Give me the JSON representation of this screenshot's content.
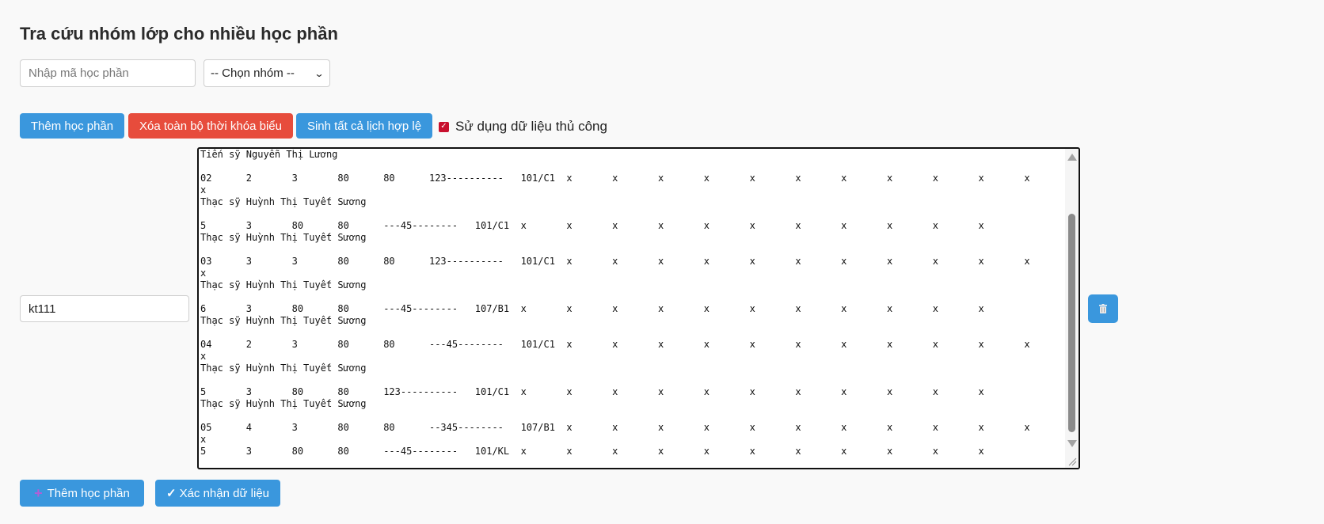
{
  "page": {
    "title": "Tra cứu nhóm lớp cho nhiều học phần"
  },
  "search": {
    "placeholder": "Nhập mã học phần",
    "group_select": "-- Chọn nhóm --"
  },
  "toolbar": {
    "add_course": "Thêm học phần",
    "clear_all": "Xóa toàn bộ thời khóa biểu",
    "generate_all": "Sinh tất cả lịch hợp lệ",
    "manual_data_label": "Sử dụng dữ liệu thủ công",
    "manual_data_checked": true
  },
  "course_row": {
    "code": "kt111",
    "data": "Tiến sỹ Nguyễn Thị Lương\n\n02      2       3       80      80      123----------   101/C1  x       x       x       x       x       x       x       x       x       x       x\nx\nThạc sỹ Huỳnh Thị Tuyết Sương\n\n5       3       80      80      ---45--------   101/C1  x       x       x       x       x       x       x       x       x       x       x\nThạc sỹ Huỳnh Thị Tuyết Sương\n\n03      3       3       80      80      123----------   101/C1  x       x       x       x       x       x       x       x       x       x       x\nx\nThạc sỹ Huỳnh Thị Tuyết Sương\n\n6       3       80      80      ---45--------   107/B1  x       x       x       x       x       x       x       x       x       x       x\nThạc sỹ Huỳnh Thị Tuyết Sương\n\n04      2       3       80      80      ---45--------   101/C1  x       x       x       x       x       x       x       x       x       x       x\nx\nThạc sỹ Huỳnh Thị Tuyết Sương\n\n5       3       80      80      123----------   101/C1  x       x       x       x       x       x       x       x       x       x       x\nThạc sỹ Huỳnh Thị Tuyết Sương\n\n05      4       3       80      80      --345--------   107/B1  x       x       x       x       x       x       x       x       x       x       x\nx\n5       3       80      80      ---45--------   101/KL  x       x       x       x       x       x       x       x       x       x       x"
  },
  "footer": {
    "add_course": "Thêm học phần",
    "confirm": "Xác nhận dữ liệu"
  },
  "colors": {
    "primary": "#3a97dd",
    "danger": "#e74c3c",
    "checkbox": "#c8102e"
  },
  "icons": {
    "delete": "trash-icon",
    "add": "plus-icon",
    "confirm": "checkmark-icon"
  }
}
